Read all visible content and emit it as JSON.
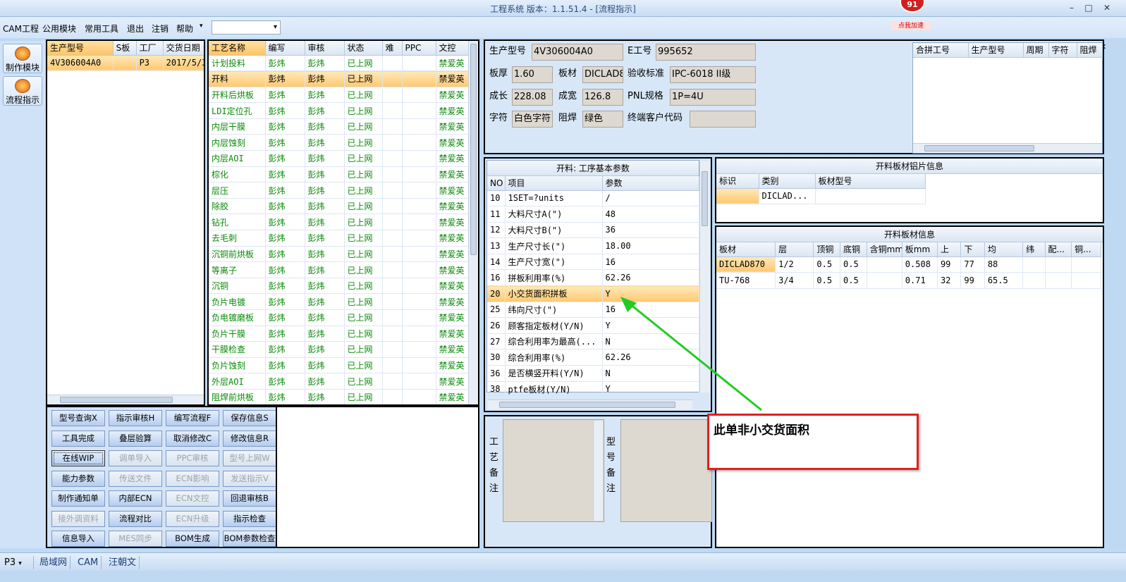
{
  "window": {
    "title": "工程系统  版本：1.1.51.4 - [流程指示]"
  },
  "menu": {
    "items": [
      "CAM工程",
      "公用模块",
      "常用工具",
      "退出",
      "注销",
      "帮助"
    ],
    "dropdown_arrow": "▾"
  },
  "badge": {
    "count": "91",
    "label": "点我加速"
  },
  "sidebar": {
    "items": [
      "制作模块",
      "流程指示"
    ]
  },
  "order_grid": {
    "columns": [
      "生产型号",
      "S板",
      "工厂",
      "交货日期"
    ],
    "rows": [
      [
        "4V306004A0",
        "",
        "P3",
        "2017/5/30"
      ]
    ]
  },
  "process_grid": {
    "columns": [
      "工艺名称",
      "编写",
      "审核",
      "状态",
      "难",
      "PPC",
      "文控"
    ],
    "rows": [
      [
        "计划投料",
        "彭炜",
        "彭炜",
        "已上网",
        "",
        "",
        "禁爱英"
      ],
      [
        "开料",
        "彭炜",
        "彭炜",
        "已上网",
        "",
        "",
        "禁爱英"
      ],
      [
        "开料后烘板",
        "彭炜",
        "彭炜",
        "已上网",
        "",
        "",
        "禁爱英"
      ],
      [
        "LDI定位孔",
        "彭炜",
        "彭炜",
        "已上网",
        "",
        "",
        "禁爱英"
      ],
      [
        "内层干膜",
        "彭炜",
        "彭炜",
        "已上网",
        "",
        "",
        "禁爱英"
      ],
      [
        "内层蚀刻",
        "彭炜",
        "彭炜",
        "已上网",
        "",
        "",
        "禁爱英"
      ],
      [
        "内层AOI",
        "彭炜",
        "彭炜",
        "已上网",
        "",
        "",
        "禁爱英"
      ],
      [
        "棕化",
        "彭炜",
        "彭炜",
        "已上网",
        "",
        "",
        "禁爱英"
      ],
      [
        "层压",
        "彭炜",
        "彭炜",
        "已上网",
        "",
        "",
        "禁爱英"
      ],
      [
        "除胶",
        "彭炜",
        "彭炜",
        "已上网",
        "",
        "",
        "禁爱英"
      ],
      [
        "钻孔",
        "彭炜",
        "彭炜",
        "已上网",
        "",
        "",
        "禁爱英"
      ],
      [
        "去毛刺",
        "彭炜",
        "彭炜",
        "已上网",
        "",
        "",
        "禁爱英"
      ],
      [
        "沉铜前烘板",
        "彭炜",
        "彭炜",
        "已上网",
        "",
        "",
        "禁爱英"
      ],
      [
        "等离子",
        "彭炜",
        "彭炜",
        "已上网",
        "",
        "",
        "禁爱英"
      ],
      [
        "沉铜",
        "彭炜",
        "彭炜",
        "已上网",
        "",
        "",
        "禁爱英"
      ],
      [
        "负片电镀",
        "彭炜",
        "彭炜",
        "已上网",
        "",
        "",
        "禁爱英"
      ],
      [
        "负电镀磨板",
        "彭炜",
        "彭炜",
        "已上网",
        "",
        "",
        "禁爱英"
      ],
      [
        "负片干膜",
        "彭炜",
        "彭炜",
        "已上网",
        "",
        "",
        "禁爱英"
      ],
      [
        "干膜检查",
        "彭炜",
        "彭炜",
        "已上网",
        "",
        "",
        "禁爱英"
      ],
      [
        "负片蚀刻",
        "彭炜",
        "彭炜",
        "已上网",
        "",
        "",
        "禁爱英"
      ],
      [
        "外层AOI",
        "彭炜",
        "彭炜",
        "已上网",
        "",
        "",
        "禁爱英"
      ],
      [
        "阻焊前烘板",
        "彭炜",
        "彭炜",
        "已上网",
        "",
        "",
        "禁爱英"
      ]
    ],
    "selected_row": 1
  },
  "buttons": [
    [
      "型号查询X",
      "指示审核H",
      "编写流程F",
      "保存信息S"
    ],
    [
      "工具完成",
      "叠层验算",
      "取消修改C",
      "修改信息R"
    ],
    [
      "在线WIP",
      "调单导入",
      "PPC审核",
      "型号上网W"
    ],
    [
      "能力参数",
      "传送文件",
      "ECN影响",
      "发送指示V"
    ],
    [
      "制作通知单",
      "内部ECN",
      "ECN文控",
      "回退审核B"
    ],
    [
      "接外调资料",
      "流程对比",
      "ECN升级",
      "指示检查"
    ],
    [
      "信息导入",
      "MES同步",
      "BOM生成",
      "BOM参数检查"
    ]
  ],
  "buttons_disabled": [
    "调单导入",
    "PPC审核",
    "型号上网W",
    "传送文件",
    "ECN影响",
    "发送指示V",
    "ECN文控",
    "接外调资料",
    "ECN升级",
    "MES同步"
  ],
  "info": {
    "prod_model_label": "生产型号",
    "prod_model": "4V306004A0",
    "e_no_label": "E工号",
    "e_no": "995652",
    "thickness_label": "板厚",
    "thickness": "1.60",
    "material_label": "板材",
    "material": "DICLAD8",
    "acceptance_label": "验收标准",
    "acceptance": "IPC-6018 II级",
    "length_label": "成长",
    "length": "228.08",
    "width_label": "成宽",
    "width": "126.8",
    "pnl_label": "PNL规格",
    "pnl": "1P=4U",
    "char_label": "字符",
    "char": "白色字符",
    "mask_label": "阻焊",
    "mask": "绿色",
    "customer_label": "终端客户代码",
    "customer": ""
  },
  "combine_grid": {
    "columns": [
      "合拼工号",
      "生产型号",
      "周期",
      "字符",
      "阻焊"
    ]
  },
  "params": {
    "title": "开料: 工序基本参数",
    "columns": [
      "NO",
      "项目",
      "参数"
    ],
    "rows": [
      [
        "10",
        "1SET=?units",
        "/"
      ],
      [
        "11",
        "大料尺寸A(\")",
        "48"
      ],
      [
        "12",
        "大料尺寸B(\")",
        "36"
      ],
      [
        "13",
        "生产尺寸长(\")",
        "18.00"
      ],
      [
        "14",
        "生产尺寸宽(\")",
        "16"
      ],
      [
        "16",
        "拼板利用率(%)",
        "62.26"
      ],
      [
        "20",
        "小交货面积拼板",
        "Y"
      ],
      [
        "25",
        "纬向尺寸(\")",
        "16"
      ],
      [
        "26",
        "顾客指定板材(Y/N)",
        "Y"
      ],
      [
        "27",
        "综合利用率为最高(...",
        "N"
      ],
      [
        "30",
        "综合利用率(%)",
        "62.26"
      ],
      [
        "36",
        "是否横竖开料(Y/N)",
        "N"
      ],
      [
        "38",
        "ptfe板材(Y/N)",
        "Y"
      ]
    ],
    "selected_row": 6
  },
  "sheet_info": {
    "title": "开料板材铝片信息",
    "columns": [
      "标识",
      "类别",
      "板材型号"
    ],
    "rows": [
      [
        "",
        "DICLAD...",
        ""
      ]
    ]
  },
  "material_info": {
    "title": "开料板材信息",
    "columns": [
      "板材",
      "层",
      "顶铜",
      "底铜",
      "含铜mm",
      "板mm",
      "上",
      "下",
      "均",
      "纬",
      "配...",
      "铜..."
    ],
    "rows": [
      [
        "DICLAD870",
        "1/2",
        "0.5",
        "0.5",
        "",
        "0.508",
        "99",
        "77",
        "88",
        "",
        "",
        ""
      ],
      [
        "TU-768",
        "3/4",
        "0.5",
        "0.5",
        "",
        "0.71",
        "32",
        "99",
        "65.5",
        "",
        "",
        ""
      ]
    ]
  },
  "notes": {
    "process_label": "工艺备注",
    "model_label": "型号备注"
  },
  "annotation": {
    "text": "此单非小交货面积",
    "arrow_color": "#22cc22",
    "box_color": "#e02020"
  },
  "statusbar": {
    "items": [
      "P3",
      "局域网",
      "CAM",
      "汪朝文"
    ]
  }
}
